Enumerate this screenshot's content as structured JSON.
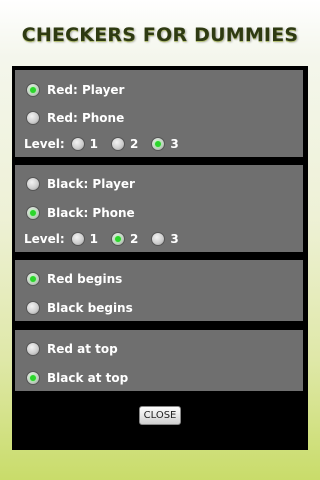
{
  "app_title": "CHECKERS FOR DUMMIES",
  "red": {
    "player_label": "Red: Player",
    "phone_label": "Red: Phone",
    "selected": "player",
    "level_label": "Level:",
    "levels": [
      "1",
      "2",
      "3"
    ],
    "selected_level": "3"
  },
  "black": {
    "player_label": "Black: Player",
    "phone_label": "Black: Phone",
    "selected": "phone",
    "level_label": "Level:",
    "levels": [
      "1",
      "2",
      "3"
    ],
    "selected_level": "2"
  },
  "start": {
    "red_begins_label": "Red begins",
    "black_begins_label": "Black begins",
    "selected": "red"
  },
  "orientation": {
    "red_top_label": "Red at top",
    "black_top_label": "Black at top",
    "selected": "black"
  },
  "close_label": "CLOSE",
  "colors": {
    "selected_dot": "#2bd52b",
    "panel": "#6f6f6f",
    "dialog": "#000000"
  }
}
